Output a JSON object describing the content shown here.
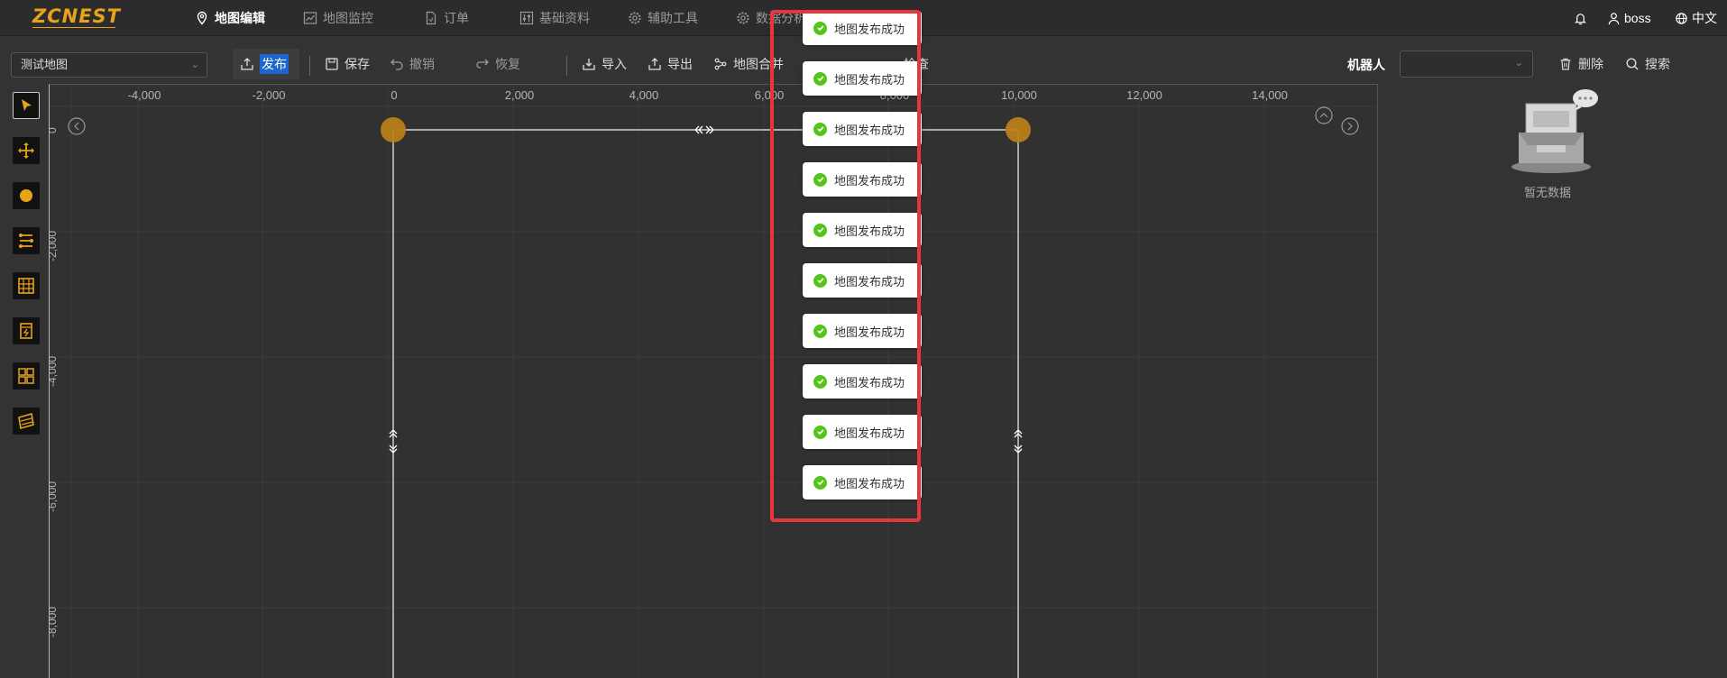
{
  "nav": {
    "logo": "ZCNEST",
    "items": [
      {
        "label": "地图编辑",
        "active": true,
        "icon": "location-pin-icon"
      },
      {
        "label": "地图监控",
        "active": false,
        "icon": "chart-line-icon"
      },
      {
        "label": "订单",
        "active": false,
        "icon": "document-icon"
      },
      {
        "label": "基础资料",
        "active": false,
        "icon": "sliders-icon"
      },
      {
        "label": "辅助工具",
        "active": false,
        "icon": "gear-icon"
      },
      {
        "label": "数据分析",
        "active": false,
        "icon": "gear-icon"
      }
    ],
    "user": "boss",
    "language": "中文"
  },
  "toolbar": {
    "map_select": "测试地图",
    "publish": "发布",
    "save": "保存",
    "undo": "撤销",
    "redo": "恢复",
    "import": "导入",
    "export": "导出",
    "merge": "地图合并",
    "check": "检查",
    "robot_label": "机器人",
    "robot_value": "",
    "delete": "删除",
    "search": "搜索"
  },
  "canvas": {
    "x_ticks": [
      "-4,000",
      "-2,000",
      "0",
      "2,000",
      "4,000",
      "6,000",
      "8,000",
      "10,000",
      "12,000",
      "14,000"
    ],
    "y_ticks": [
      "0",
      "-2,000",
      "-4,000",
      "-6,000",
      "-8,000"
    ]
  },
  "right_panel": {
    "empty_text": "暂无数据"
  },
  "messages": [
    "地图发布成功",
    "地图发布成功",
    "地图发布成功",
    "地图发布成功",
    "地图发布成功",
    "地图发布成功",
    "地图发布成功",
    "地图发布成功",
    "地图发布成功",
    "地图发布成功"
  ],
  "colors": {
    "accent": "#e8a317",
    "node": "#b8801a",
    "highlight": "#e8343c",
    "success": "#52c41a",
    "publish_label_bg": "#1c66d0"
  }
}
